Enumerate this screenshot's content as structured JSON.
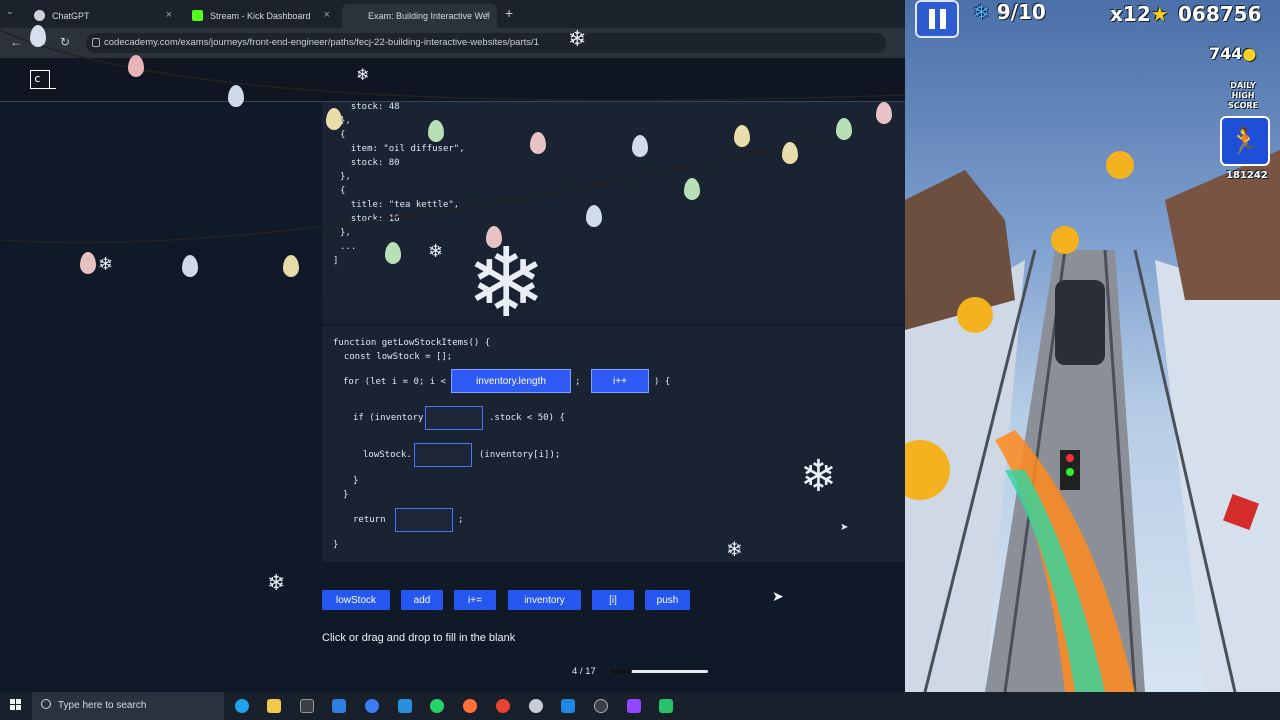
{
  "browser": {
    "tabs": [
      {
        "label": "ChatGPT",
        "favicon_color": "#cfd4d9"
      },
      {
        "label": "Stream - Kick Dashboard",
        "favicon_color": "#53fc18"
      },
      {
        "label": "Exam: Building Interactive Web",
        "favicon_color": "#2b323c"
      }
    ],
    "url": "codecademy.com/exams/journeys/front-end-engineer/paths/fecj-22-building-interactive-websites/parts/1"
  },
  "codecademy": {
    "logo": "c"
  },
  "code_top": [
    "  stock: 48",
    "},",
    "{",
    "  item: \"oil diffuser\",",
    "  stock: 80",
    "},",
    "{",
    "  title: \"tea kettle\",",
    "  stock: 16",
    "},",
    "...",
    "]"
  ],
  "exercise": {
    "line_func": "function getLowStockItems() {",
    "line_const": "  const lowStock = [];",
    "for_prefix": "for (let i = 0; i <",
    "blank_1_value": "inventory.length",
    "semicolon": ";",
    "blank_2_value": "i++",
    "for_suffix": ") {",
    "if_prefix": "if (inventory",
    "if_suffix": ".stock < 50) {",
    "push_prefix": "lowStock.",
    "push_suffix": "(inventory[i]);",
    "close_if": "}",
    "close_for": "}",
    "return_kw": "return",
    "return_semi": ";",
    "close_func": "}"
  },
  "choices": [
    "lowStock",
    "add",
    "i+=",
    "inventory",
    "[i]",
    "push"
  ],
  "instruction": "Click or drag and drop to fill in the blank",
  "progress": {
    "current": 4,
    "total": 17,
    "label": "4 / 17",
    "fraction": 0.235
  },
  "game": {
    "level": "9/10",
    "multiplier": "x12",
    "score": "068756",
    "coins": "744",
    "daily_label_1": "DAILY",
    "daily_label_2": "HIGH",
    "daily_label_3": "SCORE",
    "high_score": "181242"
  },
  "taskbar": {
    "search_placeholder": "Type here to search",
    "apps": [
      {
        "name": "edge",
        "color": "#1fa3e8"
      },
      {
        "name": "files",
        "color": "#f2c94c"
      },
      {
        "name": "terminal",
        "color": "#3a3f46"
      },
      {
        "name": "store",
        "color": "#2f7fe0"
      },
      {
        "name": "messenger",
        "color": "#3b7bf5"
      },
      {
        "name": "vscode",
        "color": "#2b8fe0"
      },
      {
        "name": "whatsapp",
        "color": "#25d366"
      },
      {
        "name": "firefox",
        "color": "#ff7139"
      },
      {
        "name": "chrome",
        "color": "#e94235"
      },
      {
        "name": "settings",
        "color": "#c9ced6"
      },
      {
        "name": "app-blue",
        "color": "#1e88e5"
      },
      {
        "name": "obs",
        "color": "#3a3f46"
      },
      {
        "name": "twitch",
        "color": "#9146ff"
      },
      {
        "name": "app-green",
        "color": "#28c26a"
      }
    ]
  }
}
